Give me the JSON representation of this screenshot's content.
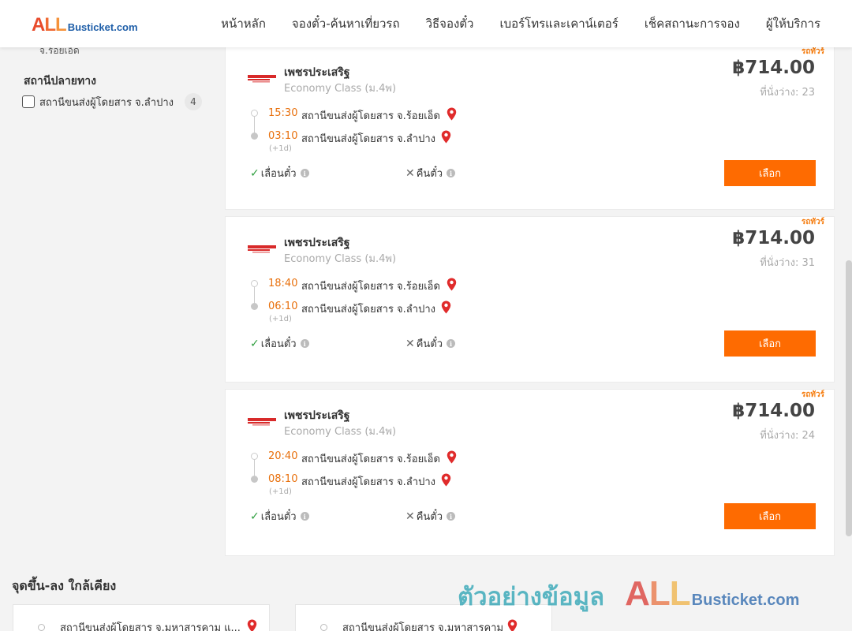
{
  "header": {
    "logo_all": "ALL",
    "logo_rest": "Busticket.com",
    "nav": [
      "หน้าหลัก",
      "จองตั๋ว-ค้นหาเที่ยวรถ",
      "วิธีจองตั๋ว",
      "เบอร์โทรและเคาน์เตอร์",
      "เช็คสถานะการจอง",
      "ผู้ให้บริการ"
    ]
  },
  "sidebar": {
    "cut_text": "จ.ร้อยเอ็ด",
    "destination_title": "สถานีปลายทาง",
    "destination_option": {
      "label": "สถานีขนส่งผู้โดยสาร จ.ลำปาง",
      "count": "4"
    }
  },
  "trips": [
    {
      "badge": "รถทัวร์",
      "operator": "เพชรประเสริฐ",
      "class": "Economy Class (ม.4พ)",
      "price": "฿714.00",
      "seats": "ที่นั่งว่าง: 23",
      "dep_time": "15:30",
      "dep_station": "สถานีขนส่งผู้โดยสาร จ.ร้อยเอ็ด",
      "arr_time": "03:10",
      "arr_station": "สถานีขนส่งผู้โดยสาร จ.ลำปาง",
      "next_day": "(+1d)",
      "reschedule": "เลื่อนตั๋ว",
      "refund": "คืนตั๋ว",
      "select": "เลือก"
    },
    {
      "badge": "รถทัวร์",
      "operator": "เพชรประเสริฐ",
      "class": "Economy Class (ม.4พ)",
      "price": "฿714.00",
      "seats": "ที่นั่งว่าง: 31",
      "dep_time": "18:40",
      "dep_station": "สถานีขนส่งผู้โดยสาร จ.ร้อยเอ็ด",
      "arr_time": "06:10",
      "arr_station": "สถานีขนส่งผู้โดยสาร จ.ลำปาง",
      "next_day": "(+1d)",
      "reschedule": "เลื่อนตั๋ว",
      "refund": "คืนตั๋ว",
      "select": "เลือก"
    },
    {
      "badge": "รถทัวร์",
      "operator": "เพชรประเสริฐ",
      "class": "Economy Class (ม.4พ)",
      "price": "฿714.00",
      "seats": "ที่นั่งว่าง: 24",
      "dep_time": "20:40",
      "dep_station": "สถานีขนส่งผู้โดยสาร จ.ร้อยเอ็ด",
      "arr_time": "08:10",
      "arr_station": "สถานีขนส่งผู้โดยสาร จ.ลำปาง",
      "next_day": "(+1d)",
      "reschedule": "เลื่อนตั๋ว",
      "refund": "คืนตั๋ว",
      "select": "เลือก"
    }
  ],
  "nearby": {
    "title": "จุดขึ้น-ลง ใกล้เคียง",
    "items": [
      "สถานีขนส่งผู้โดยสาร จ.มหาสารคาม แ...",
      "สถานีขนส่งผู้โดยสาร จ.มหาสารคาม"
    ]
  },
  "watermark": {
    "thai": "ตัวอย่างข้อมูล",
    "all": "ALL",
    "rest": "Busticket.com"
  },
  "colors": {
    "accent": "#fe6b01",
    "time": "#e8700d",
    "pin": "#e02b2b"
  },
  "icons": {
    "pin": "map-pin-icon",
    "check": "check-icon",
    "cross": "cross-icon",
    "info": "info-icon"
  }
}
